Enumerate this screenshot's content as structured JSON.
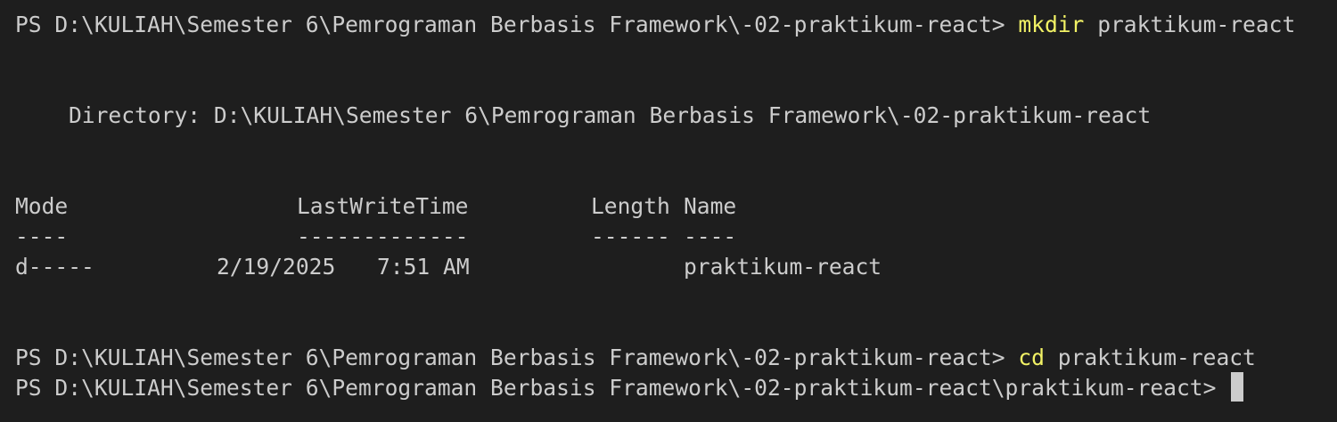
{
  "prompt_path_1": "PS D:\\KULIAH\\Semester 6\\Pemrograman Berbasis Framework\\-02-praktikum-react>",
  "cmd_1": "mkdir",
  "arg_1": "praktikum-react",
  "directory_label": "Directory:",
  "directory_path": "D:\\KULIAH\\Semester 6\\Pemrograman Berbasis Framework\\-02-praktikum-react",
  "table": {
    "headers": {
      "mode": "Mode",
      "lastwrite": "LastWriteTime",
      "length": "Length",
      "name": "Name"
    },
    "dividers": {
      "mode": "----",
      "lastwrite": "-------------",
      "length": "------",
      "name": "----"
    },
    "rows": [
      {
        "mode": "d-----",
        "date": "2/19/2025",
        "time": "7:51 AM",
        "length": "",
        "name": "praktikum-react"
      }
    ]
  },
  "prompt_path_2": "PS D:\\KULIAH\\Semester 6\\Pemrograman Berbasis Framework\\-02-praktikum-react>",
  "cmd_2": "cd",
  "arg_2": "praktikum-react",
  "prompt_path_3": "PS D:\\KULIAH\\Semester 6\\Pemrograman Berbasis Framework\\-02-praktikum-react\\praktikum-react>",
  "colors": {
    "background": "#1e1e1e",
    "text": "#cccccc",
    "command": "#f1f165"
  }
}
